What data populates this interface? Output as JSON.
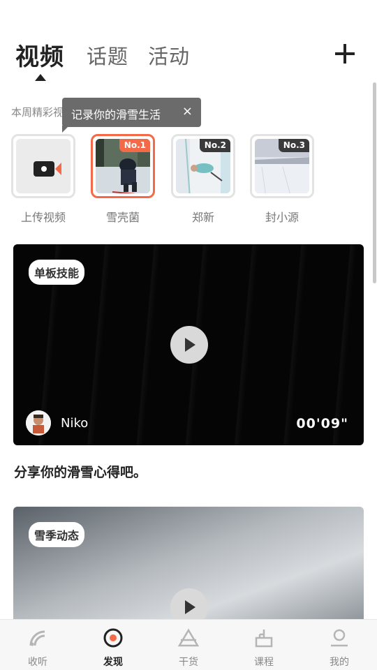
{
  "header": {
    "tabs": [
      {
        "label": "视频",
        "active": true
      },
      {
        "label": "话题",
        "active": false
      },
      {
        "label": "活动",
        "active": false
      }
    ],
    "add_icon": "plus-icon"
  },
  "section": {
    "label": "本周精彩视频"
  },
  "tooltip": {
    "text": "记录你的滑雪生活",
    "close": "×"
  },
  "stories": [
    {
      "label": "上传视频",
      "icon": "video-camera-icon"
    },
    {
      "label": "雪壳菌",
      "rank": "No.1"
    },
    {
      "label": "郑新",
      "rank": "No.2"
    },
    {
      "label": "封小源",
      "rank": "No.3"
    }
  ],
  "videos": [
    {
      "tag": "单板技能",
      "author": "Niko",
      "duration": "00'09\"",
      "caption": "分享你的滑雪心得吧。"
    },
    {
      "tag": "雪季动态"
    }
  ],
  "bottom_nav": {
    "items": [
      {
        "label": "收听",
        "icon": "broadcast-icon"
      },
      {
        "label": "发现",
        "icon": "discover-icon",
        "active": true
      },
      {
        "label": "干货",
        "icon": "triangle-icon"
      },
      {
        "label": "课程",
        "icon": "ski-lift-icon"
      },
      {
        "label": "我的",
        "icon": "profile-icon"
      }
    ]
  },
  "colors": {
    "accent": "#f46a48",
    "text": "#222222",
    "muted": "#888888"
  }
}
